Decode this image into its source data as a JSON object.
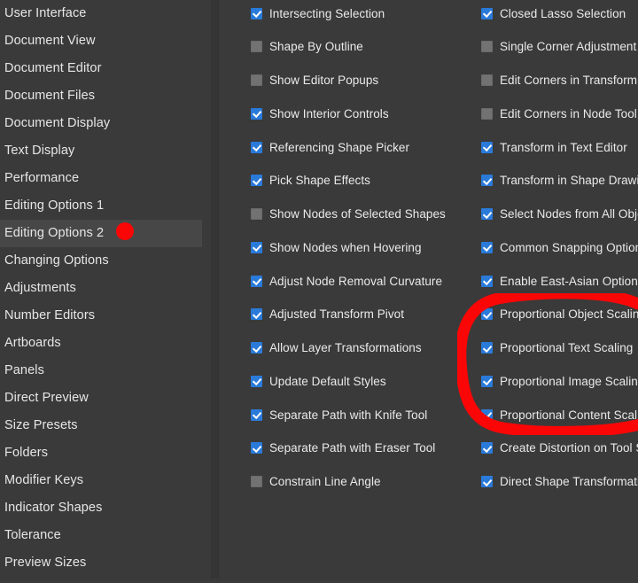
{
  "sidebar": {
    "selected": "Editing Options 2",
    "items": [
      {
        "label": "User Interface"
      },
      {
        "label": "Document View"
      },
      {
        "label": "Document Editor"
      },
      {
        "label": "Document Files"
      },
      {
        "label": "Document Display"
      },
      {
        "label": "Text Display"
      },
      {
        "label": "Performance"
      },
      {
        "label": "Editing Options 1"
      },
      {
        "label": "Editing Options 2"
      },
      {
        "label": "Changing Options"
      },
      {
        "label": "Adjustments"
      },
      {
        "label": "Number Editors"
      },
      {
        "label": "Artboards"
      },
      {
        "label": "Panels"
      },
      {
        "label": "Direct Preview"
      },
      {
        "label": "Size Presets"
      },
      {
        "label": "Folders"
      },
      {
        "label": "Modifier Keys"
      },
      {
        "label": "Indicator Shapes"
      },
      {
        "label": "Tolerance"
      },
      {
        "label": "Preview Sizes"
      }
    ]
  },
  "options": {
    "middle_column": [
      {
        "label": "Intersecting Selection",
        "checked": true
      },
      {
        "label": "Shape By Outline",
        "checked": false
      },
      {
        "label": "Show Editor Popups",
        "checked": false
      },
      {
        "label": "Show Interior Controls",
        "checked": true
      },
      {
        "label": "Referencing Shape Picker",
        "checked": true
      },
      {
        "label": "Pick Shape Effects",
        "checked": true
      },
      {
        "label": "Show Nodes of Selected Shapes",
        "checked": false
      },
      {
        "label": "Show Nodes when Hovering",
        "checked": true
      },
      {
        "label": "Adjust Node Removal Curvature",
        "checked": true
      },
      {
        "label": "Adjusted Transform Pivot",
        "checked": true
      },
      {
        "label": "Allow Layer Transformations",
        "checked": true
      },
      {
        "label": "Update Default Styles",
        "checked": true
      },
      {
        "label": "Separate Path with Knife Tool",
        "checked": true
      },
      {
        "label": "Separate Path with Eraser Tool",
        "checked": true
      },
      {
        "label": "Constrain Line Angle",
        "checked": false
      }
    ],
    "right_column": [
      {
        "label": "Closed Lasso Selection",
        "checked": true
      },
      {
        "label": "Single Corner Adjustment",
        "checked": false
      },
      {
        "label": "Edit Corners in Transform Tool",
        "checked": false
      },
      {
        "label": "Edit Corners in Node Tool",
        "checked": false
      },
      {
        "label": "Transform in Text Editor",
        "checked": true
      },
      {
        "label": "Transform in Shape Drawing",
        "checked": true
      },
      {
        "label": "Select Nodes from All Objects",
        "checked": true
      },
      {
        "label": "Common Snapping Options",
        "checked": true
      },
      {
        "label": "Enable East-Asian Options",
        "checked": true
      },
      {
        "label": "Proportional Object Scaling",
        "checked": true
      },
      {
        "label": "Proportional Text Scaling",
        "checked": true
      },
      {
        "label": "Proportional Image Scaling",
        "checked": true
      },
      {
        "label": "Proportional Content Scaling",
        "checked": true
      },
      {
        "label": "Create Distortion on Tool Select",
        "checked": true
      },
      {
        "label": "Direct Shape Transformation",
        "checked": true
      }
    ]
  },
  "annotations": {
    "dot_color": "#fa0606",
    "circle_color": "#fa0606",
    "circled_options": [
      "Proportional Object Scaling",
      "Proportional Text Scaling",
      "Proportional Image Scaling",
      "Proportional Content Scaling"
    ],
    "dot_target": "Editing Options 2"
  },
  "colors": {
    "background": "#3a3a3a",
    "selected_row": "#474747",
    "checkbox_on": "#2a7ad9",
    "checkbox_off": "#727272",
    "text": "#eaeaea",
    "primary_button": "#2f76d4",
    "secondary_button": "#7c7c7c"
  }
}
